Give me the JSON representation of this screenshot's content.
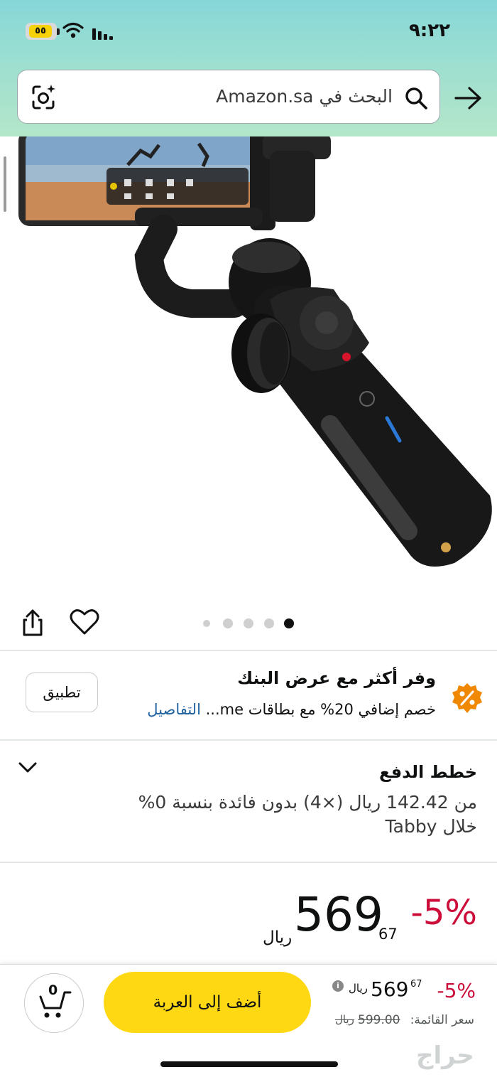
{
  "status_bar": {
    "time": "٩:٢٢",
    "battery": "٥٥"
  },
  "search": {
    "placeholder": "البحث في Amazon.sa"
  },
  "gallery": {
    "dot_count": 5,
    "active_dot": 4
  },
  "bank_offer": {
    "title": "وفر أكثر مع عرض البنك",
    "description": "خصم إضافي 20% مع بطاقات me...",
    "details_link": "التفاصيل",
    "apply_button": "تطبيق"
  },
  "payment_plans": {
    "title": "خطط الدفع",
    "description": "من 142.42 ريال (×4) بدون فائدة بنسبة 0% خلال Tabby"
  },
  "price": {
    "discount": "-5%",
    "whole": "569",
    "fraction": "67",
    "currency": "ريال"
  },
  "bottom_bar": {
    "cart_count": "0",
    "add_to_cart": "أضف إلى العربة",
    "discount": "-5%",
    "price_whole": "569",
    "price_fraction": "67",
    "currency": "ريال",
    "list_price_label": "سعر القائمة:",
    "list_price": "599.00",
    "list_currency": "ريال"
  },
  "watermark": "حراج",
  "colors": {
    "deal_red": "#cc0c39",
    "cart_yellow": "#ffd814",
    "link_blue": "#2162a1",
    "offer_orange": "#f08804"
  }
}
